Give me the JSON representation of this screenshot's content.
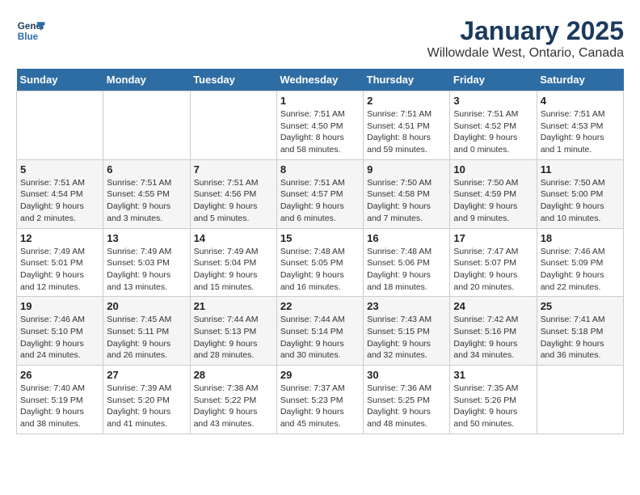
{
  "logo": {
    "line1": "General",
    "line2": "Blue"
  },
  "title": "January 2025",
  "subtitle": "Willowdale West, Ontario, Canada",
  "days_of_week": [
    "Sunday",
    "Monday",
    "Tuesday",
    "Wednesday",
    "Thursday",
    "Friday",
    "Saturday"
  ],
  "weeks": [
    [
      {
        "day": "",
        "sunrise": "",
        "sunset": "",
        "daylight": ""
      },
      {
        "day": "",
        "sunrise": "",
        "sunset": "",
        "daylight": ""
      },
      {
        "day": "",
        "sunrise": "",
        "sunset": "",
        "daylight": ""
      },
      {
        "day": "1",
        "sunrise": "Sunrise: 7:51 AM",
        "sunset": "Sunset: 4:50 PM",
        "daylight": "Daylight: 8 hours and 58 minutes."
      },
      {
        "day": "2",
        "sunrise": "Sunrise: 7:51 AM",
        "sunset": "Sunset: 4:51 PM",
        "daylight": "Daylight: 8 hours and 59 minutes."
      },
      {
        "day": "3",
        "sunrise": "Sunrise: 7:51 AM",
        "sunset": "Sunset: 4:52 PM",
        "daylight": "Daylight: 9 hours and 0 minutes."
      },
      {
        "day": "4",
        "sunrise": "Sunrise: 7:51 AM",
        "sunset": "Sunset: 4:53 PM",
        "daylight": "Daylight: 9 hours and 1 minute."
      }
    ],
    [
      {
        "day": "5",
        "sunrise": "Sunrise: 7:51 AM",
        "sunset": "Sunset: 4:54 PM",
        "daylight": "Daylight: 9 hours and 2 minutes."
      },
      {
        "day": "6",
        "sunrise": "Sunrise: 7:51 AM",
        "sunset": "Sunset: 4:55 PM",
        "daylight": "Daylight: 9 hours and 3 minutes."
      },
      {
        "day": "7",
        "sunrise": "Sunrise: 7:51 AM",
        "sunset": "Sunset: 4:56 PM",
        "daylight": "Daylight: 9 hours and 5 minutes."
      },
      {
        "day": "8",
        "sunrise": "Sunrise: 7:51 AM",
        "sunset": "Sunset: 4:57 PM",
        "daylight": "Daylight: 9 hours and 6 minutes."
      },
      {
        "day": "9",
        "sunrise": "Sunrise: 7:50 AM",
        "sunset": "Sunset: 4:58 PM",
        "daylight": "Daylight: 9 hours and 7 minutes."
      },
      {
        "day": "10",
        "sunrise": "Sunrise: 7:50 AM",
        "sunset": "Sunset: 4:59 PM",
        "daylight": "Daylight: 9 hours and 9 minutes."
      },
      {
        "day": "11",
        "sunrise": "Sunrise: 7:50 AM",
        "sunset": "Sunset: 5:00 PM",
        "daylight": "Daylight: 9 hours and 10 minutes."
      }
    ],
    [
      {
        "day": "12",
        "sunrise": "Sunrise: 7:49 AM",
        "sunset": "Sunset: 5:01 PM",
        "daylight": "Daylight: 9 hours and 12 minutes."
      },
      {
        "day": "13",
        "sunrise": "Sunrise: 7:49 AM",
        "sunset": "Sunset: 5:03 PM",
        "daylight": "Daylight: 9 hours and 13 minutes."
      },
      {
        "day": "14",
        "sunrise": "Sunrise: 7:49 AM",
        "sunset": "Sunset: 5:04 PM",
        "daylight": "Daylight: 9 hours and 15 minutes."
      },
      {
        "day": "15",
        "sunrise": "Sunrise: 7:48 AM",
        "sunset": "Sunset: 5:05 PM",
        "daylight": "Daylight: 9 hours and 16 minutes."
      },
      {
        "day": "16",
        "sunrise": "Sunrise: 7:48 AM",
        "sunset": "Sunset: 5:06 PM",
        "daylight": "Daylight: 9 hours and 18 minutes."
      },
      {
        "day": "17",
        "sunrise": "Sunrise: 7:47 AM",
        "sunset": "Sunset: 5:07 PM",
        "daylight": "Daylight: 9 hours and 20 minutes."
      },
      {
        "day": "18",
        "sunrise": "Sunrise: 7:46 AM",
        "sunset": "Sunset: 5:09 PM",
        "daylight": "Daylight: 9 hours and 22 minutes."
      }
    ],
    [
      {
        "day": "19",
        "sunrise": "Sunrise: 7:46 AM",
        "sunset": "Sunset: 5:10 PM",
        "daylight": "Daylight: 9 hours and 24 minutes."
      },
      {
        "day": "20",
        "sunrise": "Sunrise: 7:45 AM",
        "sunset": "Sunset: 5:11 PM",
        "daylight": "Daylight: 9 hours and 26 minutes."
      },
      {
        "day": "21",
        "sunrise": "Sunrise: 7:44 AM",
        "sunset": "Sunset: 5:13 PM",
        "daylight": "Daylight: 9 hours and 28 minutes."
      },
      {
        "day": "22",
        "sunrise": "Sunrise: 7:44 AM",
        "sunset": "Sunset: 5:14 PM",
        "daylight": "Daylight: 9 hours and 30 minutes."
      },
      {
        "day": "23",
        "sunrise": "Sunrise: 7:43 AM",
        "sunset": "Sunset: 5:15 PM",
        "daylight": "Daylight: 9 hours and 32 minutes."
      },
      {
        "day": "24",
        "sunrise": "Sunrise: 7:42 AM",
        "sunset": "Sunset: 5:16 PM",
        "daylight": "Daylight: 9 hours and 34 minutes."
      },
      {
        "day": "25",
        "sunrise": "Sunrise: 7:41 AM",
        "sunset": "Sunset: 5:18 PM",
        "daylight": "Daylight: 9 hours and 36 minutes."
      }
    ],
    [
      {
        "day": "26",
        "sunrise": "Sunrise: 7:40 AM",
        "sunset": "Sunset: 5:19 PM",
        "daylight": "Daylight: 9 hours and 38 minutes."
      },
      {
        "day": "27",
        "sunrise": "Sunrise: 7:39 AM",
        "sunset": "Sunset: 5:20 PM",
        "daylight": "Daylight: 9 hours and 41 minutes."
      },
      {
        "day": "28",
        "sunrise": "Sunrise: 7:38 AM",
        "sunset": "Sunset: 5:22 PM",
        "daylight": "Daylight: 9 hours and 43 minutes."
      },
      {
        "day": "29",
        "sunrise": "Sunrise: 7:37 AM",
        "sunset": "Sunset: 5:23 PM",
        "daylight": "Daylight: 9 hours and 45 minutes."
      },
      {
        "day": "30",
        "sunrise": "Sunrise: 7:36 AM",
        "sunset": "Sunset: 5:25 PM",
        "daylight": "Daylight: 9 hours and 48 minutes."
      },
      {
        "day": "31",
        "sunrise": "Sunrise: 7:35 AM",
        "sunset": "Sunset: 5:26 PM",
        "daylight": "Daylight: 9 hours and 50 minutes."
      },
      {
        "day": "",
        "sunrise": "",
        "sunset": "",
        "daylight": ""
      }
    ]
  ]
}
